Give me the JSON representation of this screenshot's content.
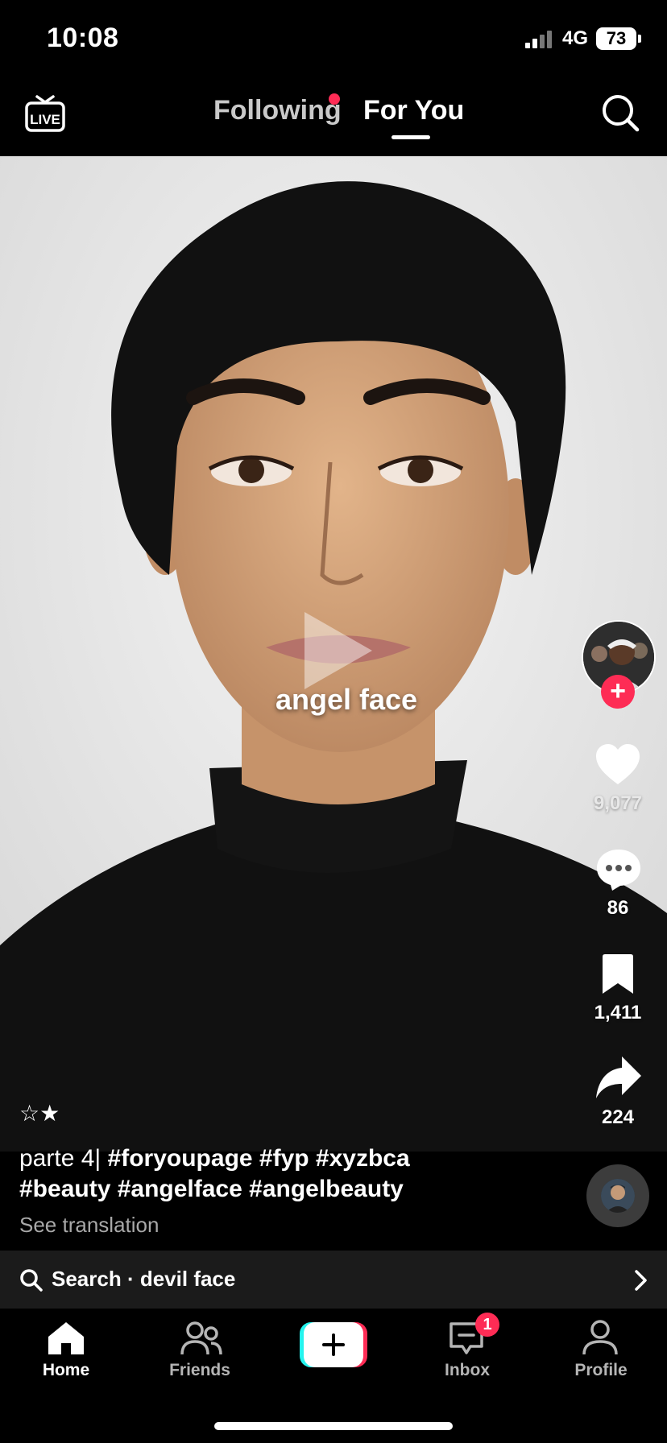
{
  "status_bar": {
    "time": "10:08",
    "network": "4G",
    "battery": "73"
  },
  "top_nav": {
    "following_label": "Following",
    "foryou_label": "For You",
    "active_tab": "For You"
  },
  "video": {
    "overlay_text": "angel face",
    "stars": "☆★"
  },
  "actions": {
    "likes": "9,077",
    "comments": "86",
    "bookmarks": "1,411",
    "shares": "224"
  },
  "caption": {
    "prefix": "parte 4|",
    "hashtags_line1": "#foryoupage #fyp #xyzbca",
    "hashtags_line2": "#beauty #angelface #angelbeauty",
    "see_translation": "See translation"
  },
  "search_suggestion": {
    "label": "Search ·",
    "query": "devil face"
  },
  "bottom_nav": {
    "home": "Home",
    "friends": "Friends",
    "inbox": "Inbox",
    "inbox_badge": "1",
    "profile": "Profile",
    "active": "Home"
  },
  "colors": {
    "accent": "#fe2c55",
    "cyan": "#25f4ee",
    "background": "#000000"
  }
}
